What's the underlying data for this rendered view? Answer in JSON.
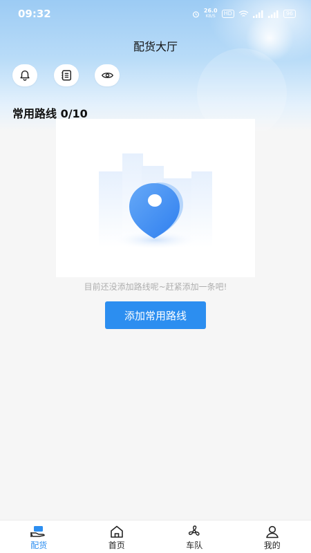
{
  "status_bar": {
    "time": "09:32",
    "speed": "26.0",
    "speed_unit": "KB/S",
    "hd": "HD",
    "battery": "96"
  },
  "header": {
    "title": "配货大厅"
  },
  "toolbar": {
    "icons": [
      "bell-icon",
      "list-icon",
      "eye-icon"
    ]
  },
  "routes": {
    "section_title": "常用路线 0/10",
    "empty_text": "目前还没添加路线呢~赶紧添加一条吧!",
    "add_button_label": "添加常用路线"
  },
  "tabbar": {
    "items": [
      {
        "label": "配货",
        "icon": "truck-hand-icon",
        "active": true
      },
      {
        "label": "首页",
        "icon": "home-icon",
        "active": false
      },
      {
        "label": "车队",
        "icon": "fan-icon",
        "active": false
      },
      {
        "label": "我的",
        "icon": "user-icon",
        "active": false
      }
    ]
  },
  "colors": {
    "accent": "#2c8ef0",
    "header_gradient_top": "#9ccbf4",
    "page_background": "#f6f6f6",
    "hint_text": "#aeaeae"
  }
}
